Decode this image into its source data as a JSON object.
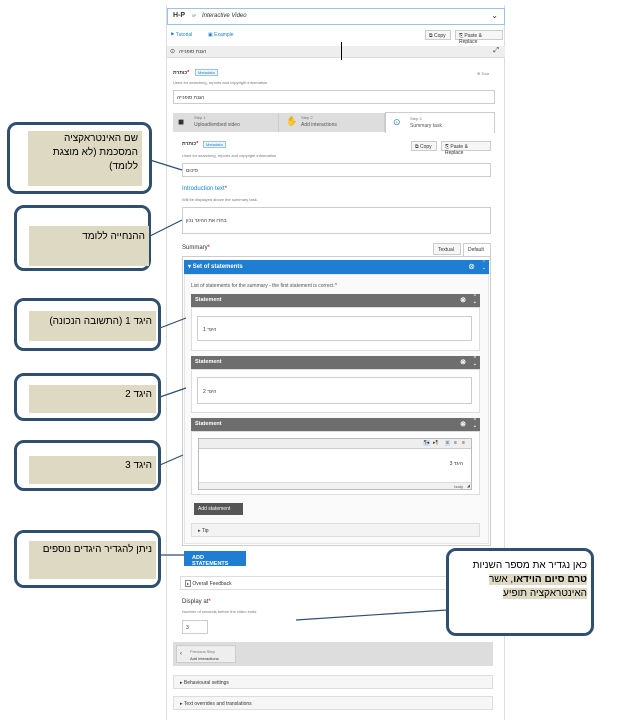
{
  "header": {
    "logo": "H-P",
    "logo_sub": "5P",
    "title": "Interactive Video",
    "tutorial": "Tutorial",
    "example": "Example",
    "copy": "Copy",
    "paste": "Paste & Replace",
    "section_title": "הגנת סופנייה"
  },
  "title_field": {
    "label": "כותרת",
    "metadata": "Metadata",
    "desc": "Used for searching, reports and copyright information",
    "value": "הגנת סופנייה",
    "tour": "Tour"
  },
  "steps": [
    {
      "step": "Step 1",
      "label": "Upload/embed video"
    },
    {
      "step": "Step 2",
      "label": "Add interactions"
    },
    {
      "step": "Step 3",
      "label": "Summary task"
    }
  ],
  "summary_title": {
    "label": "כותרת",
    "metadata": "Metadata",
    "desc": "Used for searching, reports and copyright information",
    "copy": "Copy",
    "paste": "Paste & Replace",
    "value": "סיכום"
  },
  "intro": {
    "label": "Introduction text",
    "desc": "Will be displayed above the summary task.",
    "value": "בחרו את ההיגד נכון"
  },
  "summary": {
    "label": "Summary",
    "tab_textual": "Textual",
    "tab_default": "Default",
    "set_title": "Set of statements",
    "list_desc": "List of statements for the summary - the first statement is correct.",
    "statements": [
      {
        "head": "Statement",
        "value": "היגד 1"
      },
      {
        "head": "Statement",
        "value": "היגד 2"
      },
      {
        "head": "Statement",
        "value": "היגד 3",
        "footer": "body"
      }
    ],
    "add_statement": "Add statement",
    "tip": "Tip",
    "add_statements": "ADD STATEMENTS",
    "overall_feedback": "Overall Feedback"
  },
  "display_at": {
    "label": "Display at",
    "desc": "Number of seconds before the video ends.",
    "value": "3"
  },
  "prev_step": {
    "label": "Previous Step",
    "sub": "Add interactions"
  },
  "bottom": {
    "behavioural": "Behavioural settings",
    "overrides": "Text overrides and translations"
  },
  "callouts": {
    "c1": "שם האינטראקציה המסכמת (לא מוצגת ללומד)",
    "c2": "ההנחייה ללומד",
    "c3": "היגד 1 (התשובה הנכונה)",
    "c4": "היגד 2",
    "c5": "היגד 3",
    "c6": "ניתן להגדיר היגדים נוספים",
    "c7_a": "כאן נגדיר את מספר השניות ",
    "c7_b": "טרם סיום הוידאו",
    "c7_c": ", אשר האינטראקציה תופיע"
  },
  "colors": {
    "accent": "#1f7ed1",
    "callout_border": "#2f4f6f",
    "callout_fill": "#ddd9c3"
  }
}
